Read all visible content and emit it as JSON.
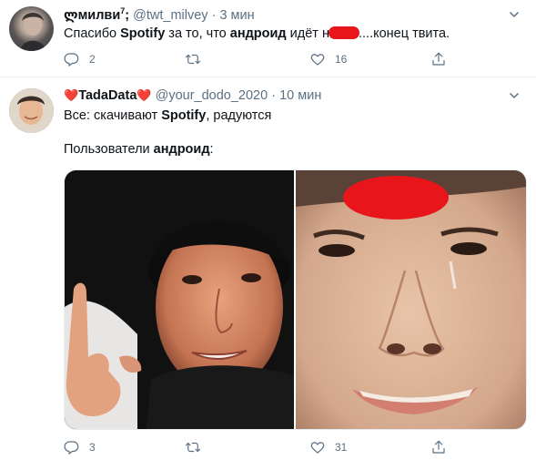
{
  "tweets": [
    {
      "name": "ლмилви",
      "name_sup": "7",
      "name_suffix": ";",
      "handle": "@twt_milvey",
      "sep": "·",
      "time": "3 мин",
      "text": {
        "p1": "Спасибо ",
        "b1": "Spotify",
        "p2": " за то, что ",
        "b2": "андроид",
        "p3": " идёт н",
        "p4": "....конец твита."
      },
      "reply_count": "2",
      "retweet_count": "",
      "like_count": "16"
    },
    {
      "name": "TadaData",
      "handle": "@your_dodo_2020",
      "sep": "·",
      "time": "10 мин",
      "line1": {
        "p1": "Все: скачивают ",
        "b1": "Spotify",
        "p2": ", радуются"
      },
      "line2": {
        "p1": "Пользователи ",
        "b1": "андроид",
        "p2": ":"
      },
      "reply_count": "3",
      "retweet_count": "",
      "like_count": "31"
    }
  ],
  "icons": {
    "reply": "reply-icon",
    "retweet": "retweet-icon",
    "like": "heart-icon",
    "share": "share-icon",
    "more": "chevron-down-icon",
    "emoji": "two-hearts-emoji"
  },
  "colors": {
    "text": "#0f1419",
    "secondary": "#5b7083",
    "border": "#e6ecf0",
    "emoji_heart": "#e0245e",
    "redaction": "#e8151b"
  }
}
